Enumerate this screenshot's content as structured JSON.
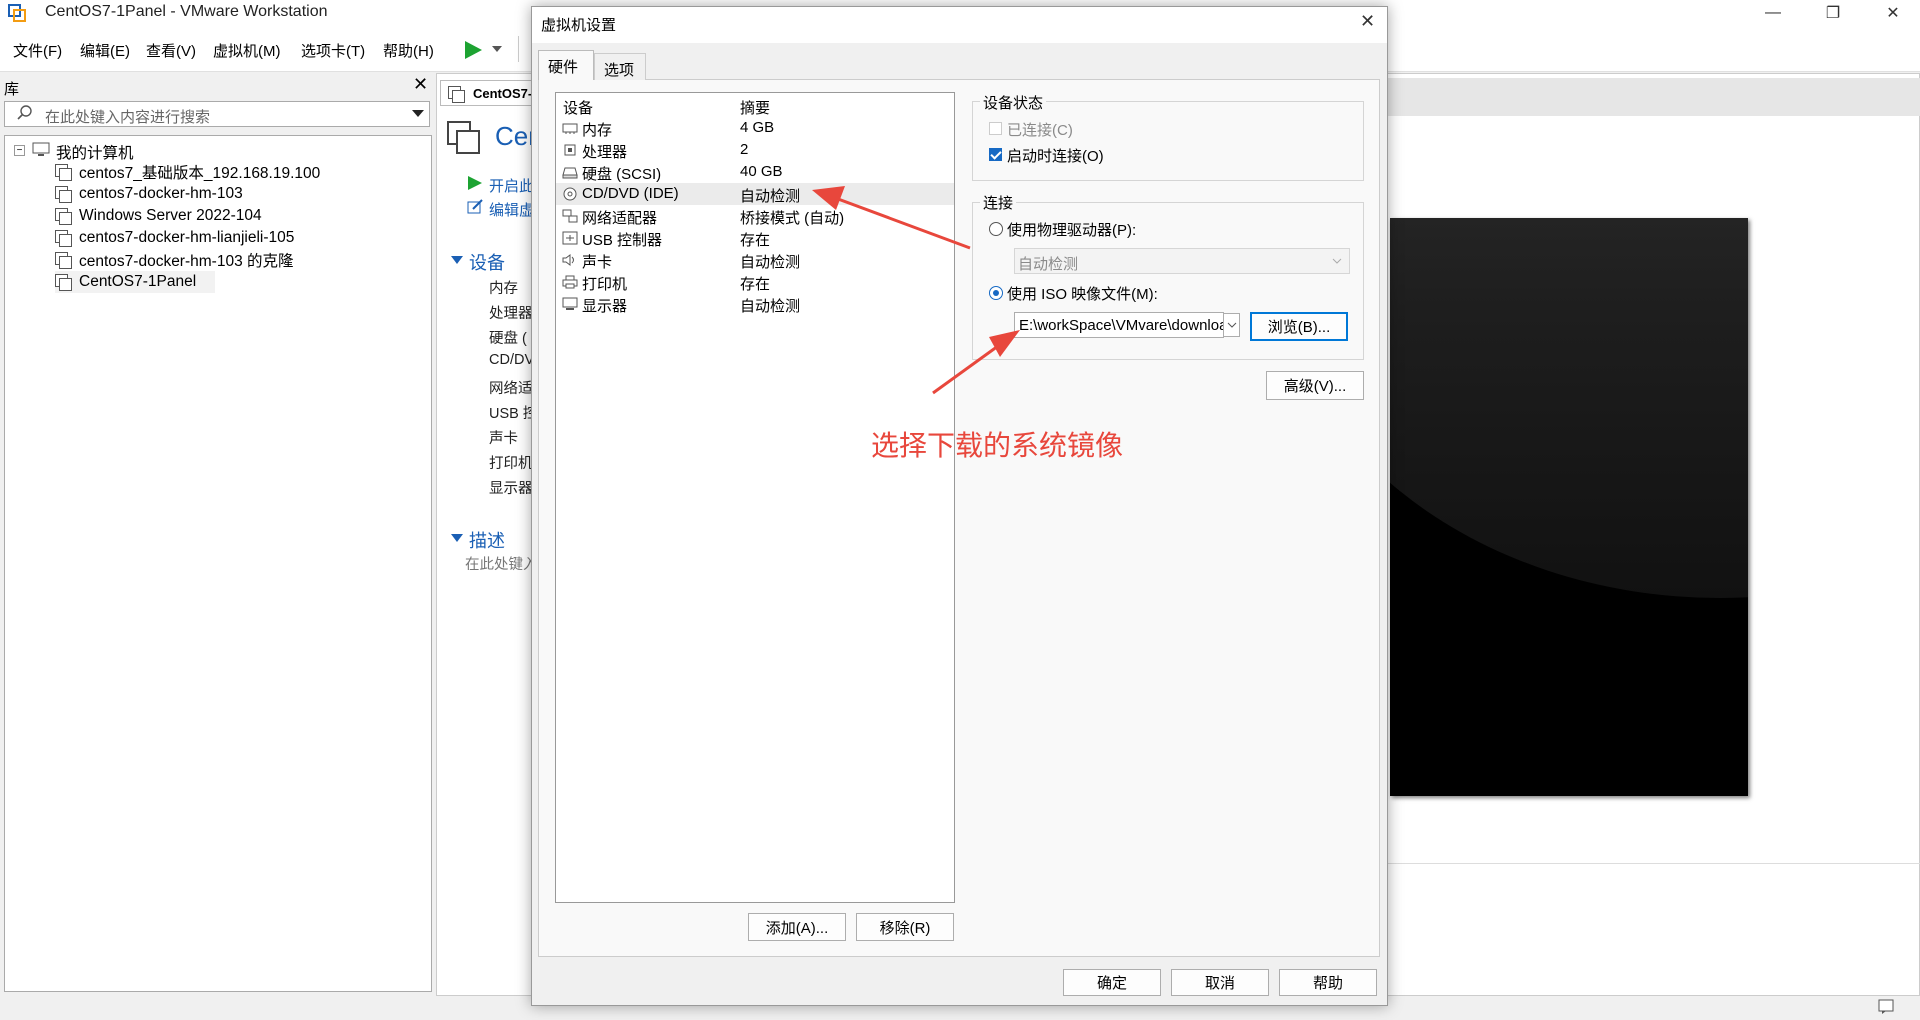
{
  "window": {
    "title": "CentOS7-1Panel - VMware Workstation"
  },
  "menu": [
    "文件(F)",
    "编辑(E)",
    "查看(V)",
    "虚拟机(M)",
    "选项卡(T)",
    "帮助(H)"
  ],
  "library": {
    "title": "库",
    "search_placeholder": "在此处键入内容进行搜索",
    "root": "我的计算机",
    "vms": [
      "centos7_基础版本_192.168.19.100",
      "centos7-docker-hm-103",
      "Windows Server 2022-104",
      "centos7-docker-hm-lianjieli-105",
      "centos7-docker-hm-103 的克隆",
      "CentOS7-1Panel"
    ]
  },
  "vm_tab": {
    "tab_label": "CentOS7-",
    "big_title": "Cer",
    "actions": [
      "开启此",
      "编辑虚"
    ],
    "devices_header": "设备",
    "devices": [
      "内存",
      "处理器",
      "硬盘 (",
      "CD/DV",
      "网络适",
      "USB 控",
      "声卡",
      "打印机",
      "显示器"
    ],
    "desc_header": "描述",
    "desc_placeholder": "在此处键入"
  },
  "dialog": {
    "title": "虚拟机设置",
    "tabs": [
      "硬件",
      "选项"
    ],
    "list_headers": {
      "device": "设备",
      "summary": "摘要"
    },
    "devices": [
      {
        "name": "内存",
        "summary": "4 GB",
        "icon": "memory-icon"
      },
      {
        "name": "处理器",
        "summary": "2",
        "icon": "cpu-icon"
      },
      {
        "name": "硬盘 (SCSI)",
        "summary": "40 GB",
        "icon": "hard-disk-icon"
      },
      {
        "name": "CD/DVD (IDE)",
        "summary": "自动检测",
        "icon": "cd-dvd-icon"
      },
      {
        "name": "网络适配器",
        "summary": "桥接模式 (自动)",
        "icon": "network-icon"
      },
      {
        "name": "USB 控制器",
        "summary": "存在",
        "icon": "usb-icon"
      },
      {
        "name": "声卡",
        "summary": "自动检测",
        "icon": "sound-icon"
      },
      {
        "name": "打印机",
        "summary": "存在",
        "icon": "printer-icon"
      },
      {
        "name": "显示器",
        "summary": "自动检测",
        "icon": "display-icon"
      }
    ],
    "add_button": "添加(A)...",
    "remove_button": "移除(R)",
    "device_status": {
      "label": "设备状态",
      "connected": "已连接(C)",
      "connect_at_power_on": "启动时连接(O)"
    },
    "connection": {
      "label": "连接",
      "physical_drive": "使用物理驱动器(P):",
      "physical_drive_value": "自动检测",
      "iso_image": "使用 ISO 映像文件(M):",
      "iso_path": "E:\\workSpace\\VMvare\\downloa",
      "browse": "浏览(B)..."
    },
    "advanced": "高级(V)...",
    "ok": "确定",
    "cancel": "取消",
    "help": "帮助"
  },
  "annotation": "选择下载的系统镜像",
  "colors": {
    "accent": "#1a5fb4",
    "annotation": "#e8473c",
    "check": "#1669c4"
  }
}
